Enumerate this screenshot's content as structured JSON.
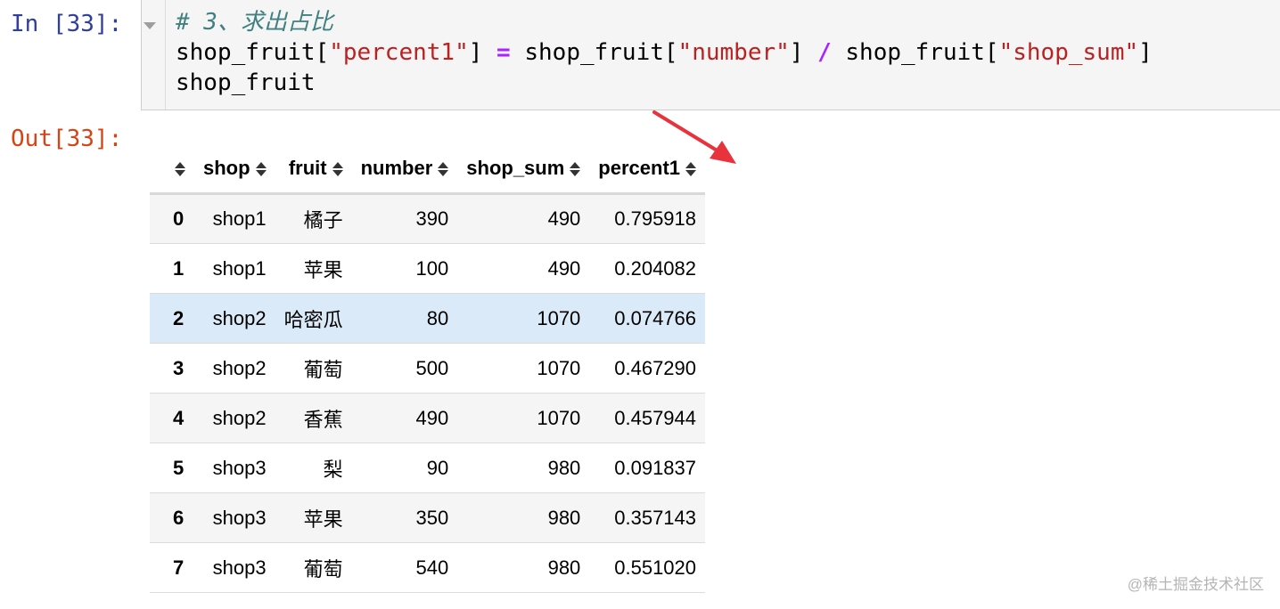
{
  "input_cell": {
    "prompt": "In [33]:",
    "code_lines": [
      [
        {
          "t": "comment",
          "v": "# 3、求出占比"
        }
      ],
      [
        {
          "t": "plain",
          "v": "shop_fruit["
        },
        {
          "t": "string",
          "v": "\"percent1\""
        },
        {
          "t": "plain",
          "v": "] "
        },
        {
          "t": "op",
          "v": "="
        },
        {
          "t": "plain",
          "v": " shop_fruit["
        },
        {
          "t": "string",
          "v": "\"number\""
        },
        {
          "t": "plain",
          "v": "] "
        },
        {
          "t": "op",
          "v": "/"
        },
        {
          "t": "plain",
          "v": " shop_fruit["
        },
        {
          "t": "string",
          "v": "\"shop_sum\""
        },
        {
          "t": "plain",
          "v": "]"
        }
      ],
      [
        {
          "t": "plain",
          "v": "shop_fruit"
        }
      ]
    ]
  },
  "output_cell": {
    "prompt": "Out[33]:"
  },
  "table": {
    "columns": [
      "shop",
      "fruit",
      "number",
      "shop_sum",
      "percent1"
    ],
    "rows": [
      {
        "index": "0",
        "cells": [
          "shop1",
          "橘子",
          "390",
          "490",
          "0.795918"
        ]
      },
      {
        "index": "1",
        "cells": [
          "shop1",
          "苹果",
          "100",
          "490",
          "0.204082"
        ]
      },
      {
        "index": "2",
        "cells": [
          "shop2",
          "哈密瓜",
          "80",
          "1070",
          "0.074766"
        ],
        "hover": true
      },
      {
        "index": "3",
        "cells": [
          "shop2",
          "葡萄",
          "500",
          "1070",
          "0.467290"
        ]
      },
      {
        "index": "4",
        "cells": [
          "shop2",
          "香蕉",
          "490",
          "1070",
          "0.457944"
        ]
      },
      {
        "index": "5",
        "cells": [
          "shop3",
          "梨",
          "90",
          "980",
          "0.091837"
        ]
      },
      {
        "index": "6",
        "cells": [
          "shop3",
          "苹果",
          "350",
          "980",
          "0.357143"
        ]
      },
      {
        "index": "7",
        "cells": [
          "shop3",
          "葡萄",
          "540",
          "980",
          "0.551020"
        ]
      }
    ]
  },
  "colors": {
    "prompt_in": "#303f9f",
    "prompt_out": "#d84315",
    "hover_row": "#dbeaf8",
    "annotation_arrow": "#e8323c"
  },
  "watermark": "@稀土掘金技术社区"
}
